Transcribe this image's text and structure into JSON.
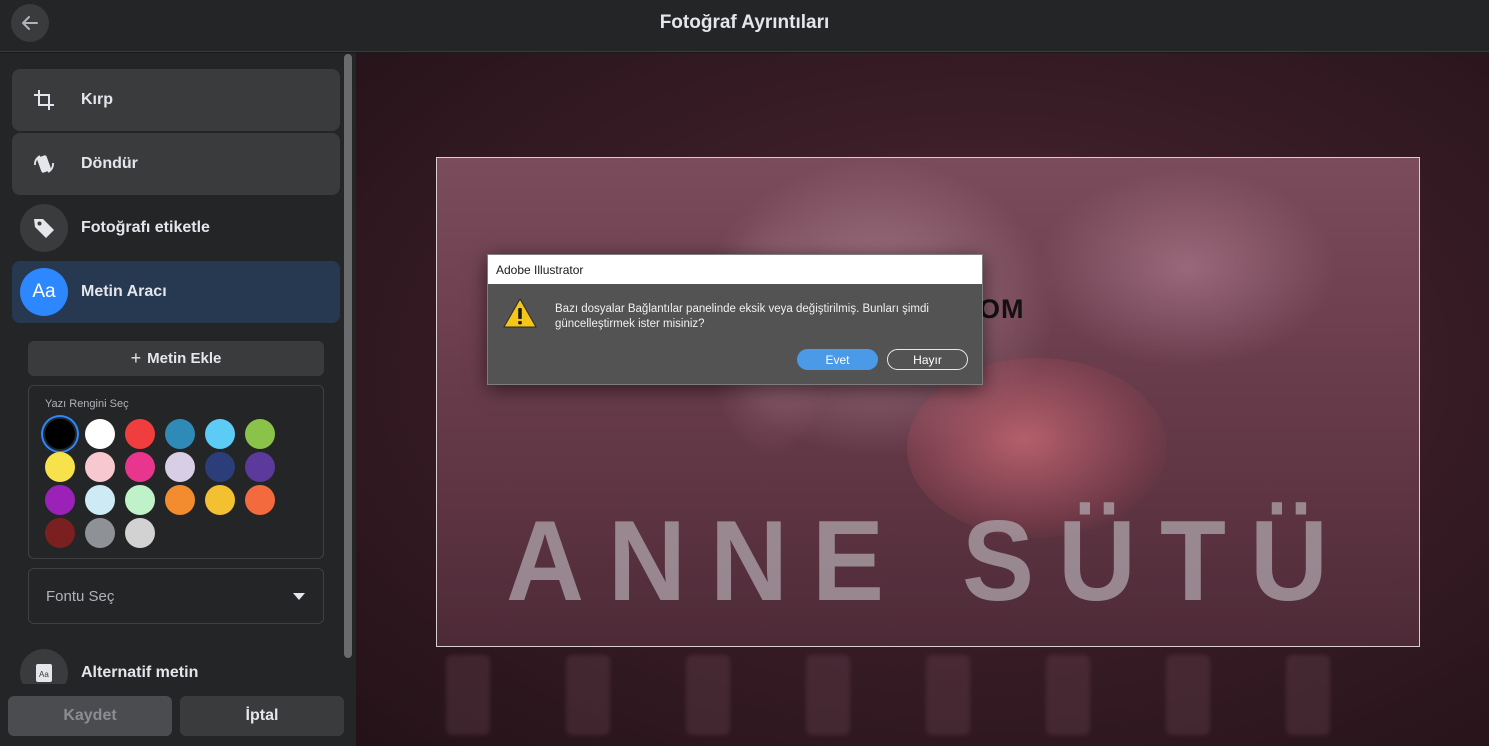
{
  "header": {
    "title": "Fotoğraf Ayrıntıları",
    "back_icon": "arrow-left-icon"
  },
  "sidebar": {
    "tools": [
      {
        "label": "Kırp",
        "icon": "crop-icon",
        "state": "selected"
      },
      {
        "label": "Döndür",
        "icon": "rotate-icon",
        "state": "selected"
      },
      {
        "label": "Fotoğrafı etiketle",
        "icon": "tag-icon",
        "state": "normal"
      },
      {
        "label": "Metin Aracı",
        "icon": "text-tool-icon",
        "icon_text": "Aa",
        "state": "active"
      }
    ],
    "add_text_label": "Metin Ekle",
    "color_panel": {
      "title": "Yazı Rengini Seç",
      "selected_index": 0,
      "colors": [
        "#000000",
        "#ffffff",
        "#f03e3e",
        "#2f8ab8",
        "#5ccbf5",
        "#8bc34a",
        "#f7e24b",
        "#f8c8d0",
        "#e8368f",
        "#d8cfe6",
        "#2b3e7a",
        "#5b3a9c",
        "#9a22b8",
        "#cdeaf5",
        "#bff2c9",
        "#f28c2e",
        "#f2c031",
        "#f26a3d",
        "#7a2020",
        "#8e9196",
        "#d2d2d2"
      ]
    },
    "font_select": {
      "label": "Fontu Seç"
    },
    "alt_text": {
      "label": "Alternatif metin",
      "icon": "alt-text-icon",
      "icon_text": "Aa"
    },
    "save_label": "Kaydet",
    "cancel_label": "İptal"
  },
  "photo": {
    "overlay_text": "OM",
    "title_text": "ANNE SÜTÜ"
  },
  "dialog": {
    "title": "Adobe Illustrator",
    "message": "Bazı dosyalar Bağlantılar panelinde eksik veya değiştirilmiş. Bunları şimdi güncelleştirmek ister misiniz?",
    "yes_label": "Evet",
    "no_label": "Hayır",
    "icon": "warning-icon",
    "accent": "#4a9ae8"
  }
}
